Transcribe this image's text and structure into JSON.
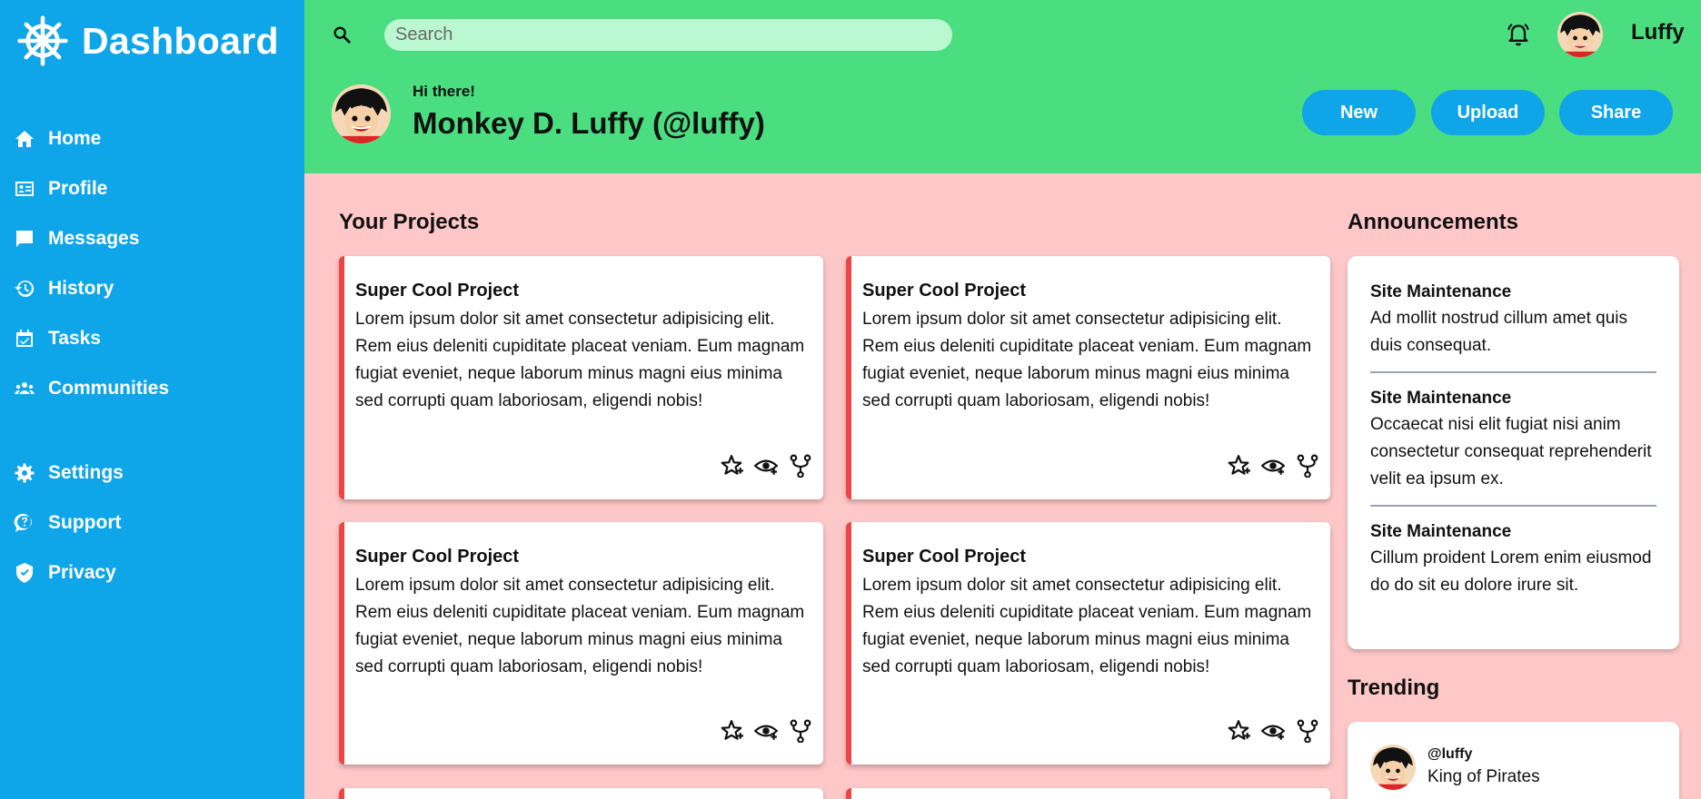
{
  "brand": {
    "title": "Dashboard",
    "icon": "ship-wheel-icon"
  },
  "sidebar": {
    "items": [
      {
        "label": "Home",
        "icon": "home-icon"
      },
      {
        "label": "Profile",
        "icon": "id-card-icon"
      },
      {
        "label": "Messages",
        "icon": "message-icon"
      },
      {
        "label": "History",
        "icon": "history-icon"
      },
      {
        "label": "Tasks",
        "icon": "calendar-check-icon"
      },
      {
        "label": "Communities",
        "icon": "group-icon"
      },
      {
        "label": "Settings",
        "icon": "gear-icon"
      },
      {
        "label": "Support",
        "icon": "help-icon"
      },
      {
        "label": "Privacy",
        "icon": "shield-icon"
      }
    ]
  },
  "header": {
    "search": {
      "placeholder": "Search",
      "value": ""
    },
    "user_name": "Luffy",
    "greeting": "Hi there!",
    "profile_name": "Monkey D. Luffy (@luffy)",
    "buttons": {
      "new": "New",
      "upload": "Upload",
      "share": "Share"
    }
  },
  "projects": {
    "title": "Your Projects",
    "items": [
      {
        "title": "Super Cool Project",
        "text": "Lorem ipsum dolor sit amet consectetur adipisicing elit. Rem eius deleniti cupiditate placeat veniam. Eum magnam fugiat eveniet, neque laborum minus magni eius minima sed corrupti quam laboriosam, eligendi nobis!"
      },
      {
        "title": "Super Cool Project",
        "text": "Lorem ipsum dolor sit amet consectetur adipisicing elit. Rem eius deleniti cupiditate placeat veniam. Eum magnam fugiat eveniet, neque laborum minus magni eius minima sed corrupti quam laboriosam, eligendi nobis!"
      },
      {
        "title": "Super Cool Project",
        "text": "Lorem ipsum dolor sit amet consectetur adipisicing elit. Rem eius deleniti cupiditate placeat veniam. Eum magnam fugiat eveniet, neque laborum minus magni eius minima sed corrupti quam laboriosam, eligendi nobis!"
      },
      {
        "title": "Super Cool Project",
        "text": "Lorem ipsum dolor sit amet consectetur adipisicing elit. Rem eius deleniti cupiditate placeat veniam. Eum magnam fugiat eveniet, neque laborum minus magni eius minima sed corrupti quam laboriosam, eligendi nobis!"
      }
    ]
  },
  "announcements": {
    "title": "Announcements",
    "items": [
      {
        "title": "Site Maintenance",
        "text": "Ad mollit nostrud cillum amet quis duis consequat."
      },
      {
        "title": "Site Maintenance",
        "text": "Occaecat nisi elit fugiat nisi anim consectetur consequat reprehenderit velit ea ipsum ex."
      },
      {
        "title": "Site Maintenance",
        "text": "Cillum proident Lorem enim eiusmod do do sit eu dolore irure sit."
      }
    ]
  },
  "trending": {
    "title": "Trending",
    "items": [
      {
        "handle": "@luffy",
        "text": "King of Pirates"
      }
    ]
  },
  "colors": {
    "sidebar": "#0ea5e9",
    "header": "#4ade80",
    "main": "#ffc8c8",
    "card_accent": "#ef4444",
    "search_bg": "#bbf7d0"
  }
}
